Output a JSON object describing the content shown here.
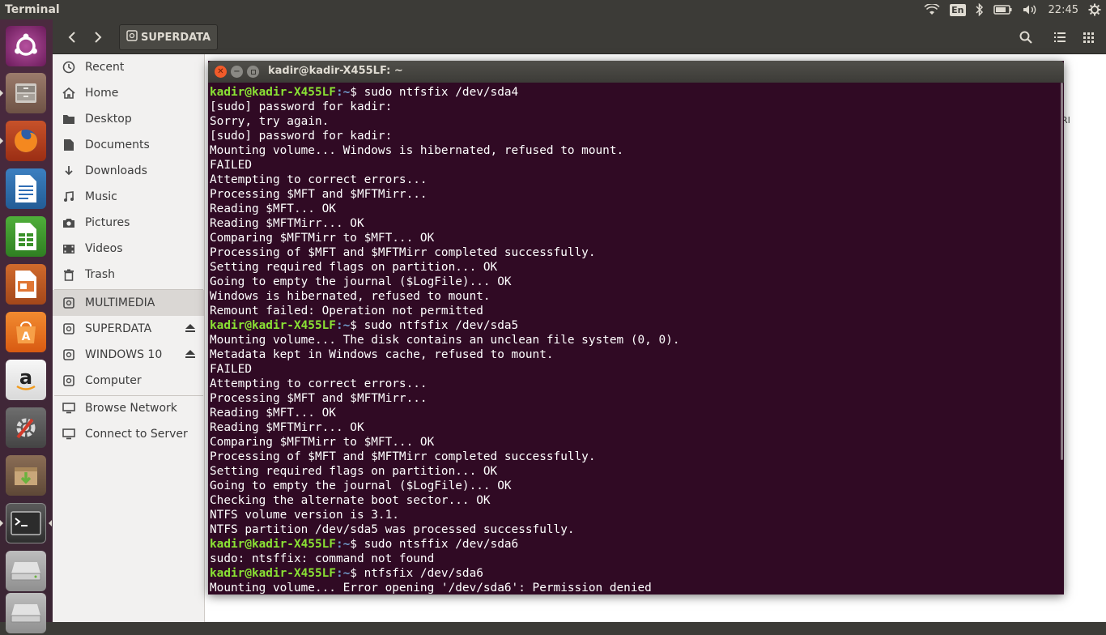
{
  "top_panel": {
    "app_title": "Terminal",
    "keyboard_layout": "En",
    "clock": "22:45",
    "icons": [
      "wifi-icon",
      "bluetooth-icon",
      "battery-icon",
      "volume-icon",
      "gear-icon"
    ]
  },
  "launcher": {
    "items": [
      {
        "name": "ubuntu-dash",
        "icon": "ubuntu-logo-icon"
      },
      {
        "name": "files",
        "icon": "file-cabinet-icon"
      },
      {
        "name": "firefox",
        "icon": "firefox-icon"
      },
      {
        "name": "libreoffice-writer",
        "icon": "writer-icon"
      },
      {
        "name": "libreoffice-calc",
        "icon": "calc-icon"
      },
      {
        "name": "libreoffice-impress",
        "icon": "impress-icon"
      },
      {
        "name": "ubuntu-software",
        "icon": "software-center-icon"
      },
      {
        "name": "amazon",
        "icon": "amazon-icon"
      },
      {
        "name": "system-settings",
        "icon": "settings-icon"
      },
      {
        "name": "archive-manager",
        "icon": "package-icon"
      },
      {
        "name": "terminal",
        "icon": "terminal-icon"
      },
      {
        "name": "drive",
        "icon": "drive-icon"
      },
      {
        "name": "drive-2",
        "icon": "drive-icon"
      }
    ]
  },
  "nautilus": {
    "path_label": "SUPERDATA",
    "sidebar": {
      "places": [
        "Recent",
        "Home",
        "Desktop",
        "Documents",
        "Downloads",
        "Music",
        "Pictures",
        "Videos",
        "Trash"
      ],
      "devices": [
        "MULTIMEDIA",
        "SUPERDATA",
        "WINDOWS 10",
        "Computer"
      ],
      "network": [
        "Browse Network",
        "Connect to Server"
      ]
    },
    "peek_text": "RI"
  },
  "terminal": {
    "title": "kadir@kadir-X455LF: ~",
    "prompt_user": "kadir@kadir-X455LF",
    "prompt_path": ":~",
    "lines": [
      {
        "prompt": true,
        "text": "$ sudo ntfsfix /dev/sda4"
      },
      {
        "prompt": false,
        "text": "[sudo] password for kadir:"
      },
      {
        "prompt": false,
        "text": "Sorry, try again."
      },
      {
        "prompt": false,
        "text": "[sudo] password for kadir:"
      },
      {
        "prompt": false,
        "text": "Mounting volume... Windows is hibernated, refused to mount."
      },
      {
        "prompt": false,
        "text": "FAILED"
      },
      {
        "prompt": false,
        "text": "Attempting to correct errors..."
      },
      {
        "prompt": false,
        "text": "Processing $MFT and $MFTMirr..."
      },
      {
        "prompt": false,
        "text": "Reading $MFT... OK"
      },
      {
        "prompt": false,
        "text": "Reading $MFTMirr... OK"
      },
      {
        "prompt": false,
        "text": "Comparing $MFTMirr to $MFT... OK"
      },
      {
        "prompt": false,
        "text": "Processing of $MFT and $MFTMirr completed successfully."
      },
      {
        "prompt": false,
        "text": "Setting required flags on partition... OK"
      },
      {
        "prompt": false,
        "text": "Going to empty the journal ($LogFile)... OK"
      },
      {
        "prompt": false,
        "text": "Windows is hibernated, refused to mount."
      },
      {
        "prompt": false,
        "text": "Remount failed: Operation not permitted"
      },
      {
        "prompt": true,
        "text": "$ sudo ntfsfix /dev/sda5"
      },
      {
        "prompt": false,
        "text": "Mounting volume... The disk contains an unclean file system (0, 0)."
      },
      {
        "prompt": false,
        "text": "Metadata kept in Windows cache, refused to mount."
      },
      {
        "prompt": false,
        "text": "FAILED"
      },
      {
        "prompt": false,
        "text": "Attempting to correct errors..."
      },
      {
        "prompt": false,
        "text": "Processing $MFT and $MFTMirr..."
      },
      {
        "prompt": false,
        "text": "Reading $MFT... OK"
      },
      {
        "prompt": false,
        "text": "Reading $MFTMirr... OK"
      },
      {
        "prompt": false,
        "text": "Comparing $MFTMirr to $MFT... OK"
      },
      {
        "prompt": false,
        "text": "Processing of $MFT and $MFTMirr completed successfully."
      },
      {
        "prompt": false,
        "text": "Setting required flags on partition... OK"
      },
      {
        "prompt": false,
        "text": "Going to empty the journal ($LogFile)... OK"
      },
      {
        "prompt": false,
        "text": "Checking the alternate boot sector... OK"
      },
      {
        "prompt": false,
        "text": "NTFS volume version is 3.1."
      },
      {
        "prompt": false,
        "text": "NTFS partition /dev/sda5 was processed successfully."
      },
      {
        "prompt": true,
        "text": "$ sudo ntsffix /dev/sda6"
      },
      {
        "prompt": false,
        "text": "sudo: ntsffix: command not found"
      },
      {
        "prompt": true,
        "text": "$ ntfsfix /dev/sda6"
      },
      {
        "prompt": false,
        "text": "Mounting volume... Error opening '/dev/sda6': Permission denied"
      }
    ]
  },
  "colors": {
    "terminal_bg": "#300a24",
    "prompt_user": "#8ae234",
    "prompt_path": "#729fcf",
    "panel_bg": "#3c3b37",
    "close_button": "#f15b2a"
  }
}
